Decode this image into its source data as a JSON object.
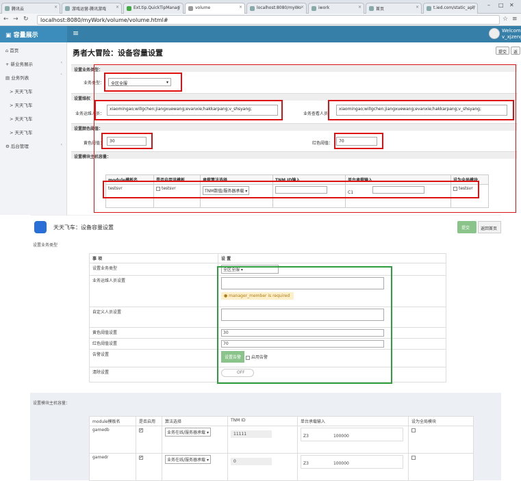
{
  "browser": {
    "tabs": [
      "腾讯云",
      "游戏运营-腾讯游戏",
      "Ext.tip.QuickTipManag",
      "volume",
      "localhost:8080/myWo",
      "iwork",
      "首页",
      "t.ied.com/static_api/"
    ],
    "url": "localhost:8080/myWork/volume/volume.html#"
  },
  "app": {
    "brand": "容量展示",
    "user_line1": "Welcom",
    "user_line2": "v_xjzeng",
    "sidebar": [
      {
        "label": "首页",
        "icon": "home-icon"
      },
      {
        "label": "新业务展示",
        "icon": "plus-icon"
      },
      {
        "label": "业务列表",
        "icon": "list-icon"
      },
      {
        "label": "天天飞车"
      },
      {
        "label": "天天飞车"
      },
      {
        "label": "天天飞车"
      },
      {
        "label": "天天飞车"
      },
      {
        "label": "后台管理",
        "icon": "gear-icon"
      }
    ],
    "page_title": "勇者大冒险：设备容量设置",
    "submit_label": "提交",
    "back_label": "返回",
    "sec_type": "设置业务类型：",
    "type_label": "业务类型：",
    "type_value": "全区全服",
    "sec_people": "设置维权",
    "ops_label": "业务运维人员：",
    "ops_value": "xiaomingao;willgchen;jiangxuewang;evanxie;hakkarpang;v_shsyang;",
    "viewer_label": "业务查看人员：",
    "viewer_value": "xiaomingao;willgchen;jiangxuewang;evanxie;hakkarpang;v_shsyang;",
    "sec_threshold": "设置颜色阈值：",
    "yellow_label": "黄色阈值：",
    "yellow_value": "30",
    "red_label": "红色阈值：",
    "red_value": "70",
    "sec_modules": "设置模块主机容量：",
    "table_headers": [
      "module模板名",
      "是否启用该模板",
      "承载算法选择",
      "TNM ID输入",
      "单台承载输入",
      "设为全局模块"
    ],
    "row": {
      "name": "testsvr",
      "enable": "testsvr",
      "algo": "TNM数值/服务器承载",
      "tnm": "",
      "capacity_label": "C1",
      "global": "testsvr"
    }
  },
  "app2": {
    "title": "天天飞车：设备容量设置",
    "submit_label": "提交",
    "back_label": "返回首页",
    "sec_type": "设置业务类型",
    "col_item": "事 项",
    "col_setting": "设 置",
    "rows": [
      {
        "label": "设置业务类型",
        "value": "全区全服"
      },
      {
        "label": "业务运维人员设置",
        "value": ""
      },
      {
        "label": "自定义人员设置",
        "value": ""
      },
      {
        "label": "黄色阈值设置",
        "value": "30"
      },
      {
        "label": "红色阈值设置",
        "value": "70"
      },
      {
        "label": "告警设置",
        "value": ""
      },
      {
        "label": "清除设置",
        "value": ""
      }
    ],
    "warning": "manager_member is required",
    "alarm_button": "设置告警",
    "alarm_check": "启用告警",
    "toggle_label": "OFF",
    "sec_modules": "设置模块主机容量：",
    "table_headers": [
      "module模板名",
      "是否启用",
      "算法选择",
      "TNM ID",
      "单台承载输入",
      "设为全局模块"
    ],
    "modules": [
      {
        "name": "gamedb",
        "algo": "业务在线/服务器承载",
        "tnm": "11111",
        "cap_label": "Z3",
        "cap_value": "100000"
      },
      {
        "name": "gamedr",
        "algo": "业务在线/服务器承载",
        "tnm": "0",
        "cap_label": "Z3",
        "cap_value": "100000"
      }
    ]
  }
}
